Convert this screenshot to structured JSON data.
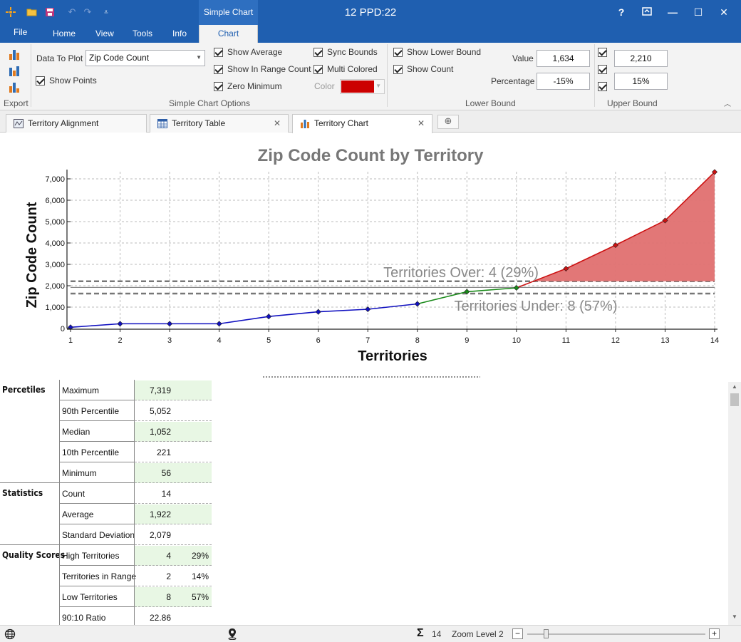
{
  "window": {
    "title": "12 PPD:22",
    "context_tab_group": "Simple Chart",
    "controls": {
      "help": "?",
      "minimize": "—",
      "maximize": "☐",
      "close": "✕"
    }
  },
  "ribbon_tabs": [
    "File",
    "Home",
    "View",
    "Tools",
    "Info",
    "Chart"
  ],
  "ribbon": {
    "export_label": "Export",
    "data_to_plot_label": "Data To Plot",
    "data_to_plot_value": "Zip Code Count",
    "show_points": "Show Points",
    "show_average": "Show Average",
    "show_in_range_count": "Show In Range Count",
    "zero_minimum": "Zero Minimum",
    "sync_bounds": "Sync Bounds",
    "multi_colored": "Multi Colored",
    "color_label": "Color",
    "color_value": "#cc0000",
    "simple_chart_options": "Simple Chart Options",
    "show_lower_bound": "Show Lower Bound",
    "show_count": "Show Count",
    "value_label": "Value",
    "percentage_label": "Percentage",
    "lower_value": "1,634",
    "lower_percentage": "-15%",
    "lower_bound_label": "Lower Bound",
    "upper_value": "2,210",
    "upper_percentage": "15%",
    "upper_bound_label": "Upper Bound"
  },
  "doc_tabs": [
    {
      "label": "Territory Alignment",
      "closable": false
    },
    {
      "label": "Territory Table",
      "closable": true
    },
    {
      "label": "Territory Chart",
      "closable": true,
      "active": true
    }
  ],
  "chart_data": {
    "type": "line",
    "title": "Zip Code Count by Territory",
    "xlabel": "Territories",
    "ylabel": "Zip Code Count",
    "x": [
      1,
      2,
      3,
      4,
      5,
      6,
      7,
      8,
      9,
      10,
      11,
      12,
      13,
      14
    ],
    "y": [
      56,
      221,
      221,
      221,
      560,
      780,
      900,
      1150,
      1720,
      1900,
      2800,
      3900,
      5052,
      7319
    ],
    "xlim": [
      1,
      14
    ],
    "ylim": [
      0,
      7000
    ],
    "yticks": [
      "0",
      "1,000",
      "2,000",
      "3,000",
      "4,000",
      "5,000",
      "6,000",
      "7,000"
    ],
    "grid": true,
    "lower_bound": 1634,
    "upper_bound": 2210,
    "average": 1922,
    "annotations": [
      "Territories Over: 4 (29%)",
      "Territories Under: 8 (57%)"
    ],
    "colors": {
      "low": "#1010c0",
      "in_range": "#1a8a1a",
      "high": "#cc1111",
      "high_fill": "#e07070"
    }
  },
  "stats": {
    "groups": [
      {
        "name": "Percetiles",
        "rows": [
          {
            "name": "Maximum",
            "value": "7,319"
          },
          {
            "name": "90th Percentile",
            "value": "5,052"
          },
          {
            "name": "Median",
            "value": "1,052"
          },
          {
            "name": "10th Percentile",
            "value": "221"
          },
          {
            "name": "Minimum",
            "value": "56"
          }
        ]
      },
      {
        "name": "Statistics",
        "rows": [
          {
            "name": "Count",
            "value": "14"
          },
          {
            "name": "Average",
            "value": "1,922"
          },
          {
            "name": "Standard Deviation",
            "value": "2,079"
          }
        ]
      },
      {
        "name": "Quality Scores",
        "rows": [
          {
            "name": "High Territories",
            "value": "4",
            "pct": "29%"
          },
          {
            "name": "Territories in Range",
            "value": "2",
            "pct": "14%"
          },
          {
            "name": "Low Territories",
            "value": "8",
            "pct": "57%"
          },
          {
            "name": "90:10 Ratio",
            "value": "22.86"
          }
        ]
      }
    ]
  },
  "statusbar": {
    "count": "14",
    "zoom_label": "Zoom Level 2"
  }
}
